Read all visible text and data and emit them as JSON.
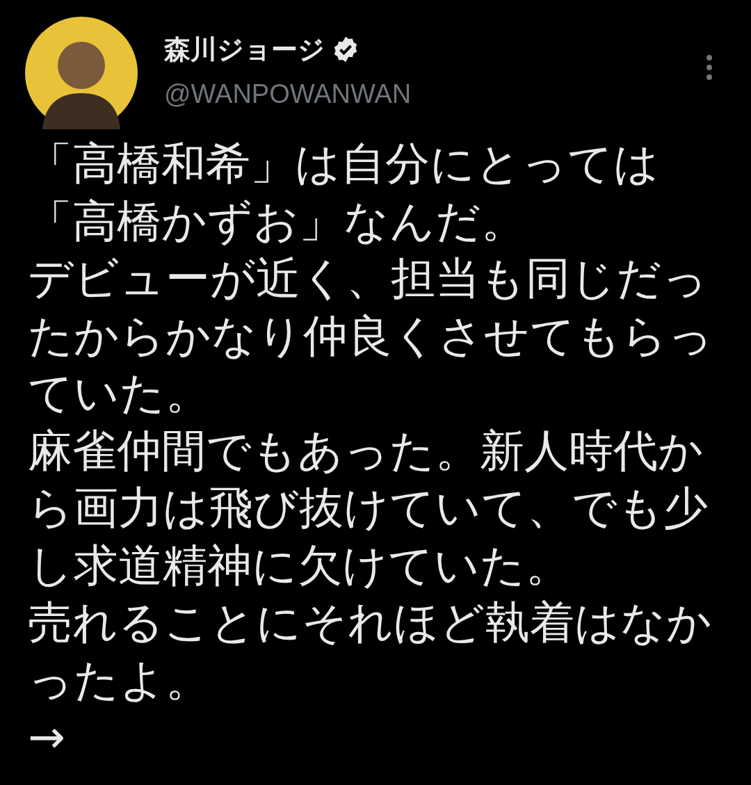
{
  "author": {
    "name": "森川ジョージ",
    "verified": true,
    "handle": "@WANPOWANWAN"
  },
  "body": [
    "「高橋和希」は自分にとっては「高橋かずお」なんだ。",
    "デビューが近く、担当も同じだったからかなり仲良くさせてもらっていた。",
    "麻雀仲間でもあった。新人時代から画力は飛び抜けていて、でも少し求道精神に欠けていた。",
    "売れることにそれほど執着はなかったよ。",
    "→"
  ]
}
